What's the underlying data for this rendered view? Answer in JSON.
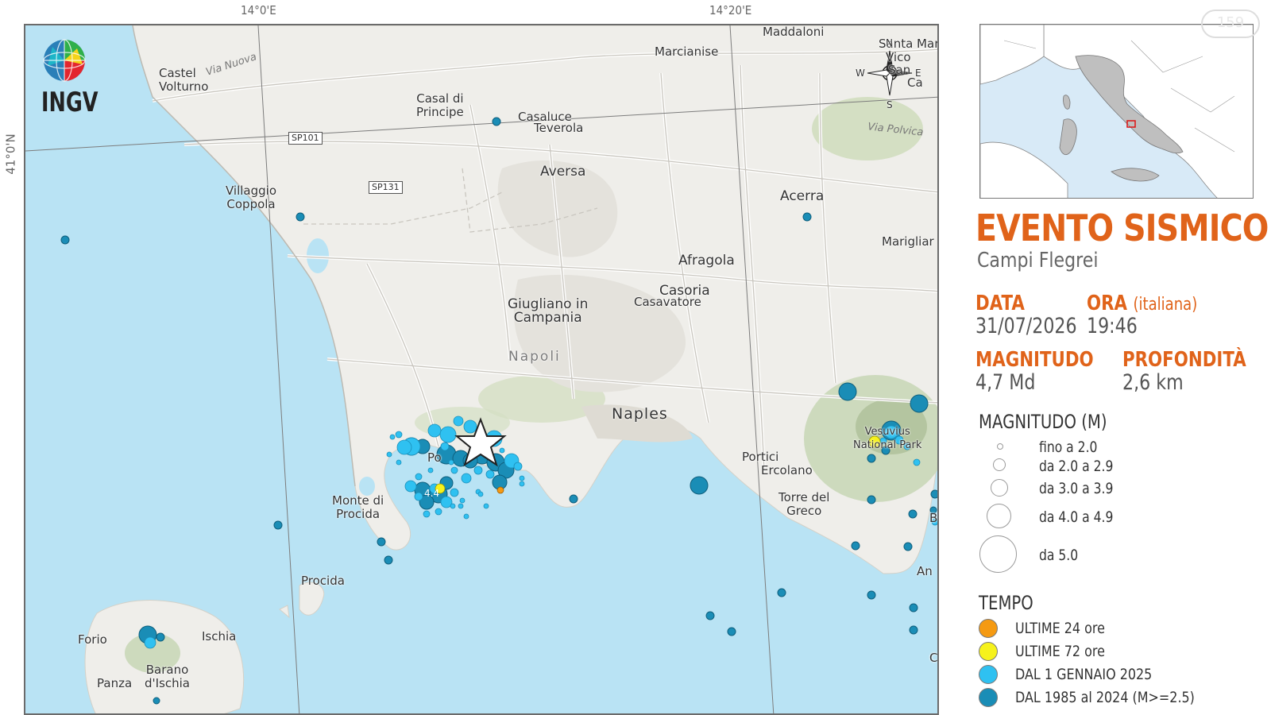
{
  "app": {
    "org": "INGV"
  },
  "grid": {
    "lon_labels": [
      "14°0'E",
      "14°20'E"
    ],
    "lat_labels": [
      "41°0'N"
    ]
  },
  "map": {
    "places": {
      "castel_volturno": "Castel\nVolturno",
      "via_nuova": "Via Nuova",
      "casal_di_principe": "Casal di\nPrincipe",
      "casaluce": "Casaluce",
      "teverola": "Teverola",
      "marcianise": "Marcianise",
      "maddaloni": "Maddaloni",
      "santa_maria": "Santa Mar",
      "vico": "Vico",
      "san": "San",
      "ca": "Ca",
      "via_polvica": "Via Polvica",
      "aversa": "Aversa",
      "villaggio_coppola": "Villaggio\nCoppola",
      "acerra": "Acerra",
      "marigliano": "Marigliar",
      "afragola": "Afragola",
      "casoria": "Casoria",
      "casavatore": "Casavatore",
      "giugliano": "Giugliano in\nCampania",
      "napoli": "Napoli",
      "naples": "Naples",
      "portici": "Portici",
      "ercolano": "Ercolano",
      "torre_del_greco": "Torre del\nGreco",
      "vesuvius": "Vesuvius\nNational Park",
      "monte_di_procida": "Monte di\nProcida",
      "procida": "Procida",
      "ischia": "Ischia",
      "forio": "Forio",
      "barano": "Barano\nd'Ischia",
      "panza": "Panza",
      "pozzuoli": "Po",
      "b": "B",
      "c": "C",
      "an": "An"
    },
    "roads": [
      "SP101",
      "SP131"
    ],
    "compass": {
      "n": "N",
      "s": "S",
      "e": "E",
      "w": "W"
    },
    "event_label": "4.4"
  },
  "info": {
    "title": "EVENTO SISMICO",
    "subtitle": "Campi Flegrei",
    "data_label": "DATA",
    "data_value": "31/07/2026",
    "ora_label": "ORA",
    "ora_note": "(italiana)",
    "ora_value": "19:46",
    "magnitudo_label": "MAGNITUDO",
    "magnitudo_value": "4,7 Md",
    "profondita_label": "PROFONDITÀ",
    "profondita_value": "2,6 km"
  },
  "legend": {
    "magnitude_title": "MAGNITUDO (M)",
    "magnitude_classes": [
      "fino a 2.0",
      "da 2.0 a 2.9",
      "da 3.0 a 3.9",
      "da 4.0 a 4.9",
      "da 5.0"
    ],
    "time_title": "TEMPO",
    "time_classes": [
      {
        "label": "ULTIME 24 ore",
        "color": "#f59a12"
      },
      {
        "label": "ULTIME 72 ore",
        "color": "#f6f21c"
      },
      {
        "label": "DAL 1 GENNAIO 2025",
        "color": "#2fc1f1"
      },
      {
        "label": "DAL 1985 al 2024 (M>=2.5)",
        "color": "#1a8db6"
      }
    ]
  },
  "watermark": "159"
}
